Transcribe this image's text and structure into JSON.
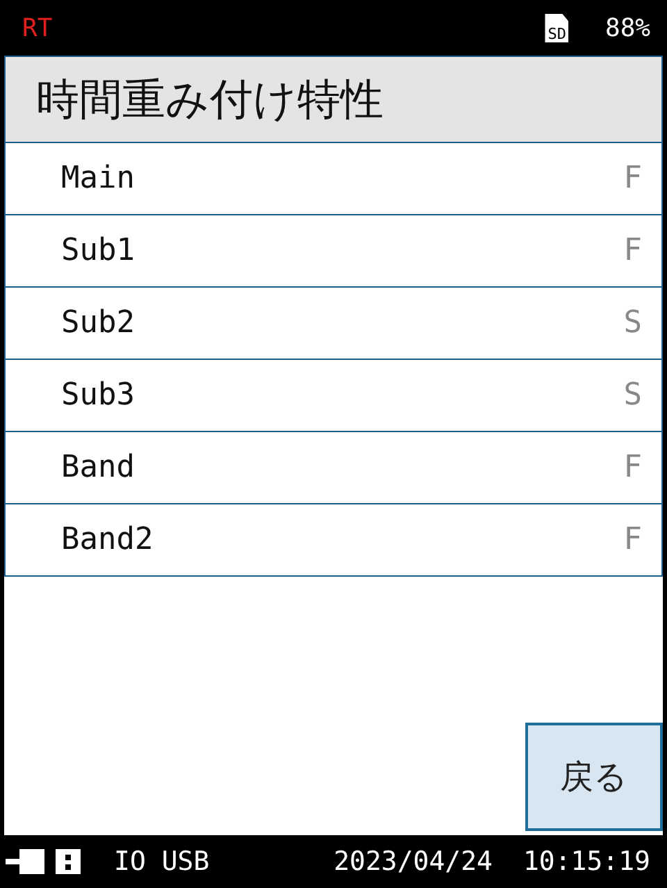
{
  "status_bar": {
    "mode": "RT",
    "storage": "SD",
    "battery": "88%"
  },
  "title": "時間重み付け特性",
  "rows": [
    {
      "label": "Main",
      "value": "F"
    },
    {
      "label": "Sub1",
      "value": "F"
    },
    {
      "label": "Sub2",
      "value": "S"
    },
    {
      "label": "Sub3",
      "value": "S"
    },
    {
      "label": "Band",
      "value": "F"
    },
    {
      "label": "Band2",
      "value": "F"
    }
  ],
  "back_button": "戻る",
  "footer": {
    "io": "IO USB",
    "date": "2023/04/24",
    "time": "10:15:19"
  }
}
